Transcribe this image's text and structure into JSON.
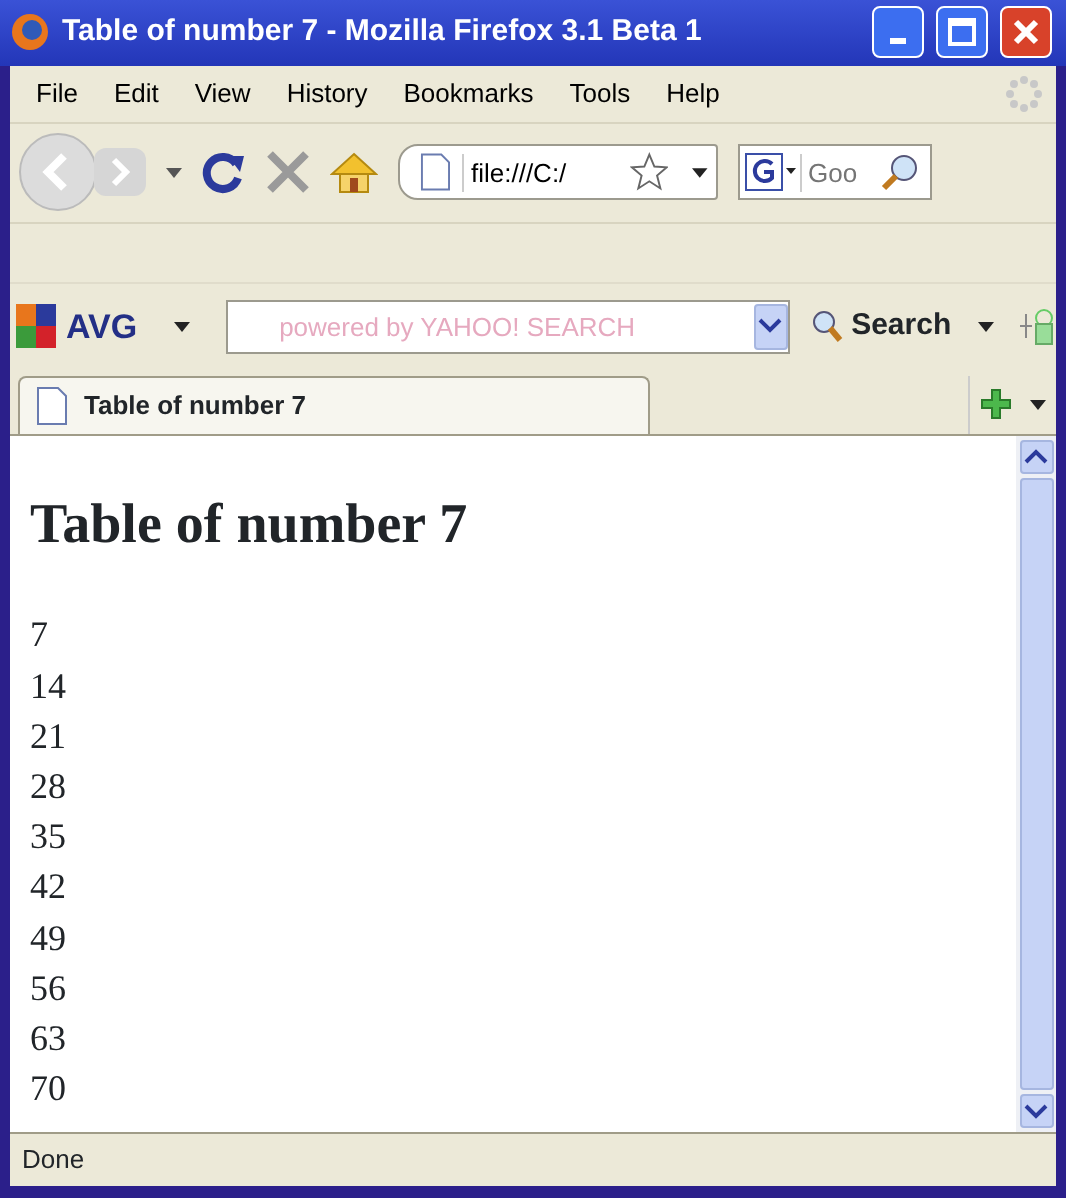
{
  "window": {
    "title": "Table of number 7 - Mozilla Firefox 3.1 Beta 1"
  },
  "menu": [
    "File",
    "Edit",
    "View",
    "History",
    "Bookmarks",
    "Tools",
    "Help"
  ],
  "address": {
    "value": "file:///C:/"
  },
  "web_search": {
    "placeholder": "Goo"
  },
  "toolbar": {
    "brand": "AVG",
    "search_placeholder": "powered by YAHOO! SEARCH",
    "search_button": "Search"
  },
  "tabs": [
    {
      "label": "Table of number 7",
      "selected": true
    }
  ],
  "page": {
    "heading": "Table of number 7",
    "lines": [
      "7",
      "14",
      "21",
      "28",
      "35",
      "42",
      "49",
      "56",
      "63",
      "70"
    ]
  },
  "status_bar": "Done"
}
